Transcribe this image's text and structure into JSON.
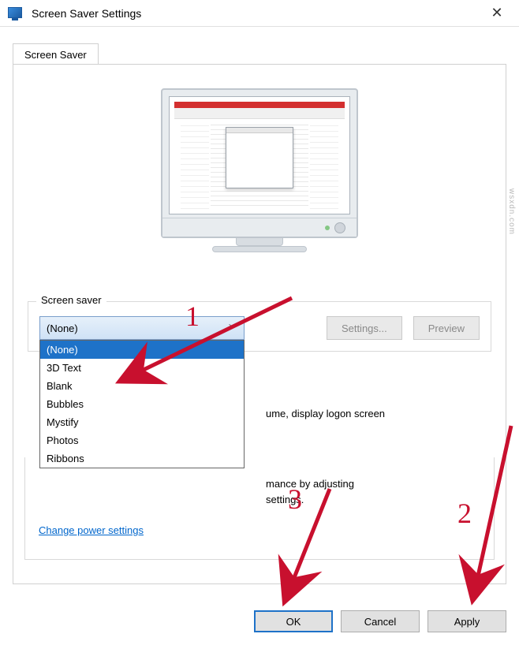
{
  "title": "Screen Saver Settings",
  "tab": {
    "label": "Screen Saver"
  },
  "group": {
    "legend": "Screen saver",
    "combo_selected": "(None)",
    "options": [
      "(None)",
      "3D Text",
      "Blank",
      "Bubbles",
      "Mystify",
      "Photos",
      "Ribbons"
    ],
    "settings_btn": "Settings...",
    "preview_btn": "Preview",
    "resume_fragment": "ume, display logon screen"
  },
  "power": {
    "fragment1": "mance by adjusting",
    "fragment2": "settings.",
    "link": "Change power settings"
  },
  "buttons": {
    "ok": "OK",
    "cancel": "Cancel",
    "apply": "Apply"
  },
  "annotations": {
    "n1": "1",
    "n2": "2",
    "n3": "3"
  },
  "watermark": "wsxdn.com"
}
